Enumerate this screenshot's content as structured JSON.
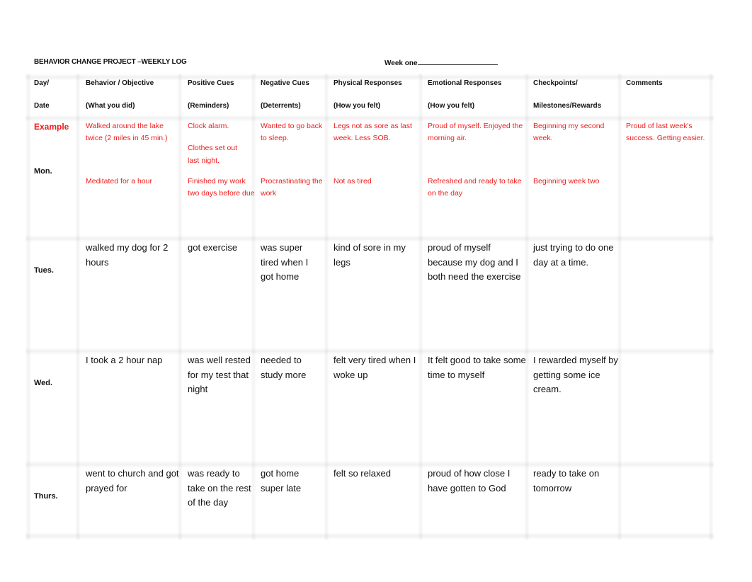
{
  "document": {
    "title": "BEHAVIOR CHANGE PROJECT –WEEKLY LOG",
    "week_label": "Week one"
  },
  "header": {
    "row1": [
      "Day/",
      "Behavior / Objective",
      "Positive Cues",
      "Negative Cues",
      "Physical Responses",
      "Emotional Responses",
      "Checkpoints/",
      "Comments"
    ],
    "row2": [
      "Date",
      "(What you did)",
      "(Reminders)",
      "(Deterrents)",
      "(How you felt)",
      "(How you felt)",
      "Milestones/Rewards",
      ""
    ]
  },
  "example": {
    "label": "Example",
    "behavior": "Walked around the lake twice (2 miles in 45 min.)",
    "positive_1": "Clock alarm.",
    "positive_2": "Clothes set out last night.",
    "negative": "Wanted to go back to sleep.",
    "physical": "Legs not as sore as last week. Less SOB.",
    "emotional": "Proud of myself. Enjoyed the morning air.",
    "checkpoints": "Beginning my second week.",
    "comments": "Proud of last week's success. Getting easier."
  },
  "rows": [
    {
      "day": "Mon.",
      "behavior": "Meditated for a hour",
      "positive": "Finished my work two days before due",
      "negative": "Procrastinating the work",
      "physical": "Not as tired",
      "emotional": "Refreshed and ready to take on the day",
      "checkpoints": "Beginning week two",
      "comments": ""
    },
    {
      "day": "Tues.",
      "behavior": "walked my dog for 2 hours",
      "positive": "got exercise",
      "negative": "was super tired when I got home",
      "physical": "kind of sore in my legs",
      "emotional": "proud of myself because my dog and I both need the exercise",
      "checkpoints": "just trying to do one day at a time.",
      "comments": ""
    },
    {
      "day": "Wed.",
      "behavior": "I took a 2 hour nap",
      "positive": "was well rested for my test that night",
      "negative": "needed to study more",
      "physical": "felt very tired when I woke up",
      "emotional": "It felt good to take some time to myself",
      "checkpoints": "I rewarded myself by getting some ice cream.",
      "comments": ""
    },
    {
      "day": "Thurs.",
      "behavior": "went to church and got prayed for",
      "positive": "was ready to take on the rest of the day",
      "negative": "got home super late",
      "physical": "felt so relaxed",
      "emotional": "proud of how close I have gotten to God",
      "checkpoints": "ready to take on tomorrow",
      "comments": ""
    }
  ],
  "colors": {
    "example_text": "#ee1c1c",
    "body_text": "#111111"
  }
}
